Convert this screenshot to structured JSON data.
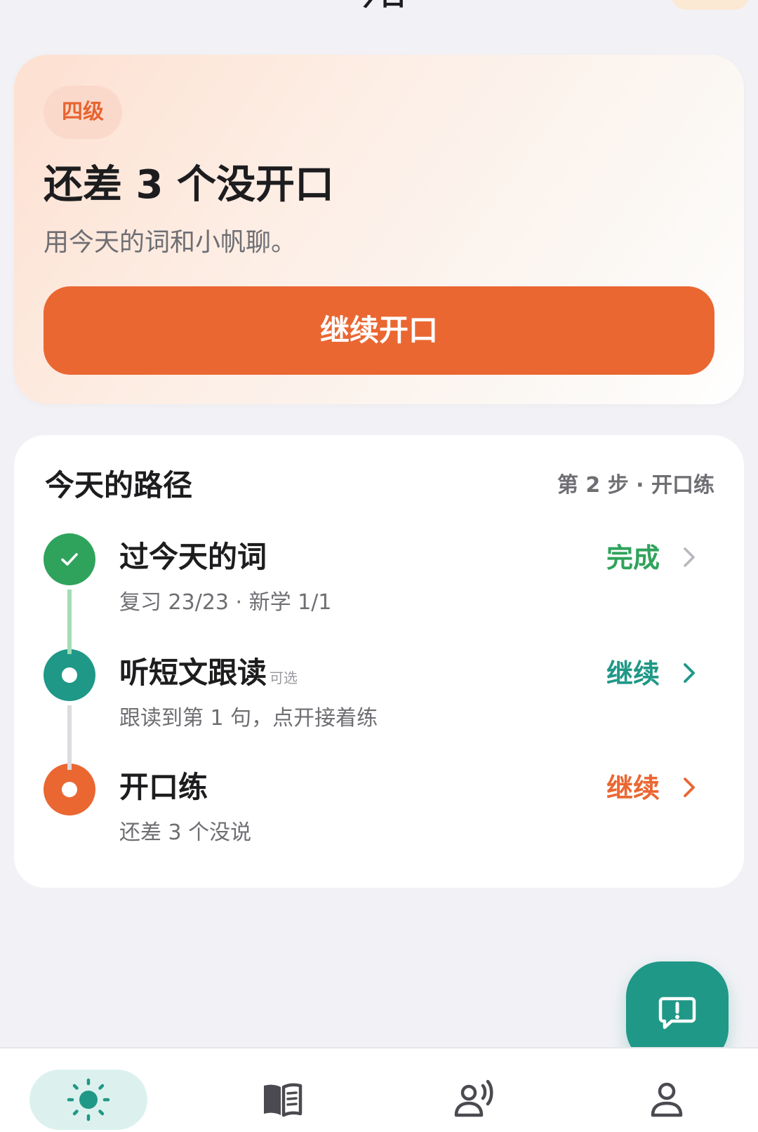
{
  "header": {
    "title": "今日"
  },
  "hero": {
    "level": "四级",
    "title": "还差 3 个没开口",
    "subtitle": "用今天的词和小帆聊。",
    "cta_label": "继续开口"
  },
  "path": {
    "title": "今天的路径",
    "progress": "第 2 步 · 开口练",
    "steps": [
      {
        "name": "过今天的词",
        "tag": "",
        "desc": "复习 23/23 · 新学 1/1",
        "action": "完成",
        "status": "done",
        "color": "#2fa35c"
      },
      {
        "name": "听短文跟读",
        "tag": "可选",
        "desc": "跟读到第 1 句，点开接着练",
        "action": "继续",
        "status": "in-progress",
        "color": "#1f9887"
      },
      {
        "name": "开口练",
        "tag": "",
        "desc": "还差 3 个没说",
        "action": "继续",
        "status": "current",
        "color": "#ea6732"
      }
    ]
  },
  "fab": {
    "icon": "feedback-icon"
  },
  "nav": {
    "items": [
      {
        "icon": "sun-icon",
        "active": true
      },
      {
        "icon": "book-icon",
        "active": false
      },
      {
        "icon": "speaking-person-icon",
        "active": false
      },
      {
        "icon": "person-icon",
        "active": false
      }
    ]
  },
  "colors": {
    "accent_orange": "#ea6732",
    "accent_teal": "#1f9887",
    "done_green": "#2fa35c"
  }
}
